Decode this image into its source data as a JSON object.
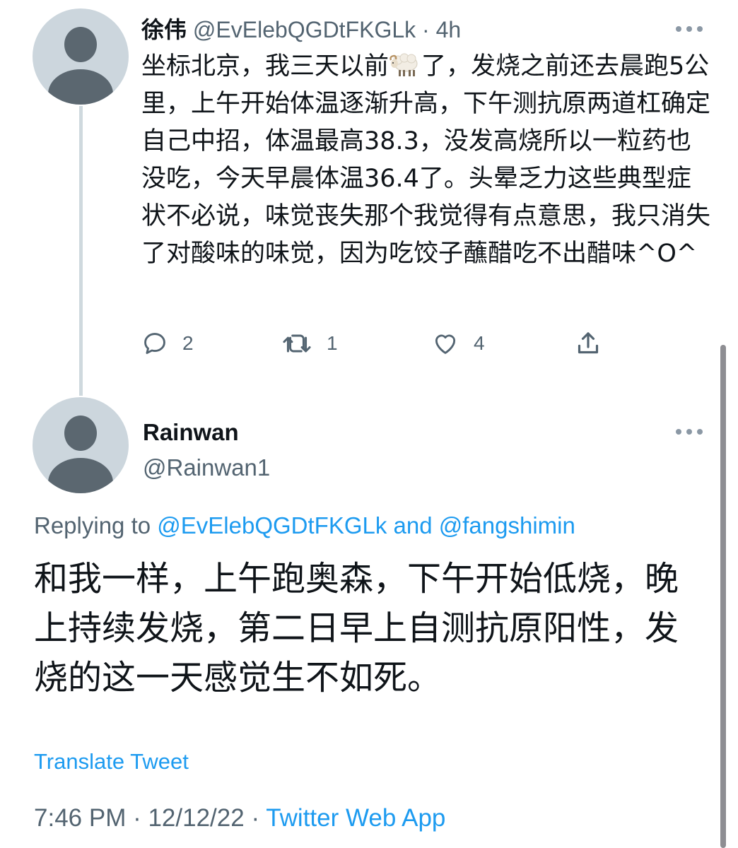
{
  "tweet1": {
    "display_name": "徐伟",
    "handle": "@EvElebQGDtFKGLk",
    "separator": "·",
    "time": "4h",
    "text_before_emoji": "坐标北京，我三天以前",
    "emoji": "sheep-emoji",
    "text_after_emoji": "了，发烧之前还去晨跑5公里，上午开始体温逐渐升高，下午测抗原两道杠确定自己中招，体温最高38.3，没发高烧所以一粒药也没吃，今天早晨体温36.4了。头晕乏力这些典型症状不必说，味觉丧失那个我觉得有点意思，我只消失了对酸味的味觉，因为吃饺子蘸醋吃不出醋味^O^",
    "actions": {
      "reply_count": "2",
      "retweet_count": "1",
      "like_count": "4"
    }
  },
  "tweet2": {
    "display_name": "Rainwan",
    "handle": "@Rainwan1",
    "replying_prefix": "Replying to ",
    "replying_user1": "@EvElebQGDtFKGLk",
    "replying_and": " and ",
    "replying_user2": "@fangshimin",
    "text": "和我一样，上午跑奥森，下午开始低烧，晚上持续发烧，第二日早上自测抗原阳性，发烧的这一天感觉生不如死。",
    "translate_label": "Translate Tweet",
    "meta": {
      "time": "7:46 PM",
      "separator": " · ",
      "date": "12/12/22",
      "source": "Twitter Web App"
    }
  },
  "colors": {
    "text_primary": "#0f1419",
    "text_secondary": "#536471",
    "link": "#1d9bf0",
    "avatar_bg": "#ccd6dd",
    "avatar_fg": "#5b6770",
    "thread_line": "#cfd9de"
  }
}
